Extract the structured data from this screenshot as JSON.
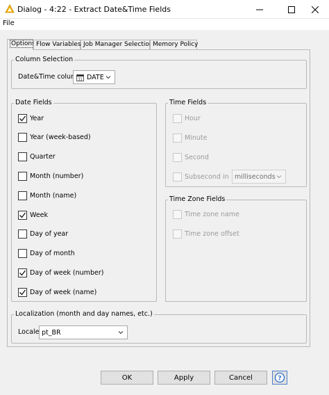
{
  "window": {
    "title": "Dialog - 4:22 - Extract Date&Time Fields",
    "minimize_icon": "minimize-icon",
    "maximize_icon": "maximize-icon",
    "close_icon": "close-icon"
  },
  "menu": {
    "file": "File"
  },
  "tabs": [
    {
      "label": "Options",
      "active": true
    },
    {
      "label": "Flow Variables",
      "active": false
    },
    {
      "label": "Job Manager Selection",
      "active": false
    },
    {
      "label": "Memory Policy",
      "active": false
    }
  ],
  "column_selection": {
    "title": "Column Selection",
    "label": "Date&Time column",
    "value": "DATE",
    "value_icon": "calendar-icon"
  },
  "date_fields": {
    "title": "Date Fields",
    "items": [
      {
        "label": "Year",
        "checked": true
      },
      {
        "label": "Year (week-based)",
        "checked": false
      },
      {
        "label": "Quarter",
        "checked": false
      },
      {
        "label": "Month (number)",
        "checked": false
      },
      {
        "label": "Month (name)",
        "checked": false
      },
      {
        "label": "Week",
        "checked": true
      },
      {
        "label": "Day of year",
        "checked": false
      },
      {
        "label": "Day of month",
        "checked": false
      },
      {
        "label": "Day of week (number)",
        "checked": true
      },
      {
        "label": "Day of week (name)",
        "checked": true
      }
    ]
  },
  "time_fields": {
    "title": "Time Fields",
    "items": [
      {
        "label": "Hour",
        "checked": false
      },
      {
        "label": "Minute",
        "checked": false
      },
      {
        "label": "Second",
        "checked": false
      },
      {
        "label": "Subsecond in",
        "checked": false
      }
    ],
    "subsecond_unit": "milliseconds"
  },
  "time_zone_fields": {
    "title": "Time Zone Fields",
    "items": [
      {
        "label": "Time zone name",
        "checked": false
      },
      {
        "label": "Time zone offset",
        "checked": false
      }
    ]
  },
  "localization": {
    "title": "Localization (month and day names, etc.)",
    "label": "Locale",
    "value": "pt_BR"
  },
  "buttons": {
    "ok": "OK",
    "apply": "Apply",
    "cancel": "Cancel",
    "help_icon": "help-icon"
  }
}
